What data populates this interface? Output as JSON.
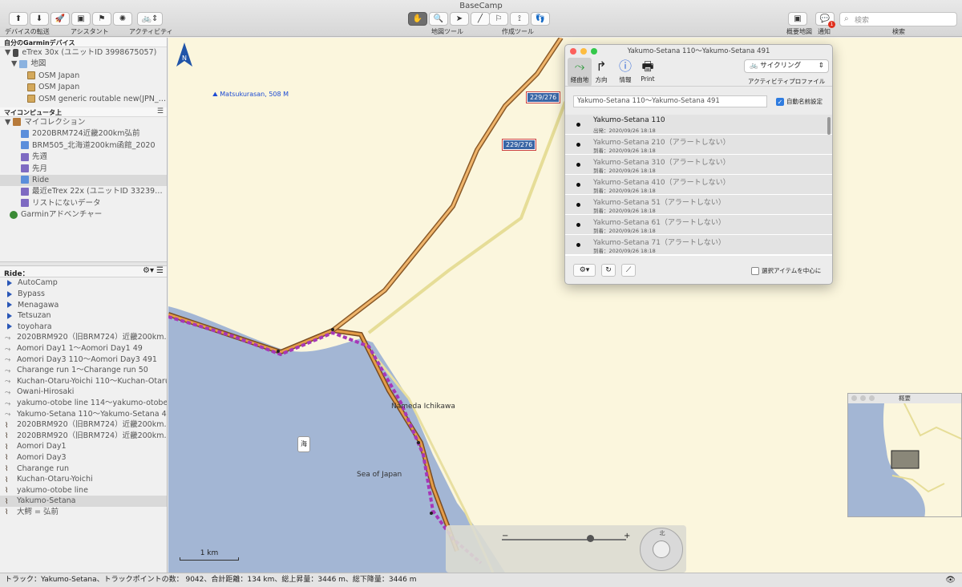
{
  "window": {
    "title": "BaseCamp"
  },
  "toolbar": {
    "groups": [
      {
        "label": "デバイスの転送"
      },
      {
        "label": "アシスタント"
      },
      {
        "label": "アクティビティ"
      },
      {
        "label": "地図ツール"
      },
      {
        "label": "作成ツール"
      },
      {
        "label": "概要地図"
      },
      {
        "label": "通知"
      },
      {
        "label": "検索"
      }
    ],
    "search_placeholder": "検索",
    "notification_count": "1"
  },
  "sidebar": {
    "device_header": "自分のGarminデバイス",
    "device_items": [
      {
        "label": "eTrex 30x (ユニットID 3998675057)"
      },
      {
        "label": "地図"
      },
      {
        "label": "OSM Japan"
      },
      {
        "label": "OSM Japan"
      },
      {
        "label": "OSM generic routable new(JPN_2..."
      }
    ],
    "computer_header": "マイコンピュータ上",
    "collection_items": [
      {
        "label": "マイコレクション"
      },
      {
        "label": "2020BRM724近畿200km弘前"
      },
      {
        "label": "BRM505_北海道200km函館_2020"
      },
      {
        "label": "先週"
      },
      {
        "label": "先月"
      },
      {
        "label": "Ride"
      },
      {
        "label": "最近eTrex 22x (ユニットID 332397..."
      },
      {
        "label": "リストにないデータ"
      },
      {
        "label": "Garminアドベンチャー"
      }
    ],
    "ride_header": "Ride：",
    "ride_items": [
      {
        "label": "AutoCamp",
        "kind": "flag"
      },
      {
        "label": "Bypass",
        "kind": "flag"
      },
      {
        "label": "Menagawa",
        "kind": "flag"
      },
      {
        "label": "Tetsuzan",
        "kind": "flag"
      },
      {
        "label": "toyohara",
        "kind": "flag"
      },
      {
        "label": "2020BRM920（旧BRM724）近畿200km...",
        "kind": "route"
      },
      {
        "label": "Aomori Day1 1〜Aomori Day1 49",
        "kind": "route"
      },
      {
        "label": "Aomori Day3 110〜Aomori Day3 491",
        "kind": "route"
      },
      {
        "label": "Charange run 1〜Charange run 50",
        "kind": "route"
      },
      {
        "label": "Kuchan-Otaru-Yoichi 110〜Kuchan-Otaru...",
        "kind": "route"
      },
      {
        "label": "Owani-Hirosaki",
        "kind": "route"
      },
      {
        "label": "yakumo-otobe line 114〜yakumo-otobe li...",
        "kind": "route"
      },
      {
        "label": "Yakumo-Setana 110〜Yakumo-Setana 491",
        "kind": "route"
      },
      {
        "label": "2020BRM920（旧BRM724）近畿200km...",
        "kind": "track"
      },
      {
        "label": "2020BRM920（旧BRM724）近畿200km...",
        "kind": "track"
      },
      {
        "label": "Aomori Day1",
        "kind": "track"
      },
      {
        "label": "Aomori Day3",
        "kind": "track"
      },
      {
        "label": "Charange run",
        "kind": "track"
      },
      {
        "label": "Kuchan-Otaru-Yoichi",
        "kind": "track"
      },
      {
        "label": "yakumo-otobe line",
        "kind": "track"
      },
      {
        "label": "Yakumo-Setana",
        "kind": "track"
      },
      {
        "label": "大鰐 = 弘前",
        "kind": "track"
      }
    ]
  },
  "map": {
    "poi_label": "Matsukurasan, 508 M",
    "shield_1": "229/276",
    "shield_2": "229/276",
    "place_label": "Nameda Ichikawa",
    "sea_label": "Sea of Japan",
    "pin_label": "海",
    "scale_label": "1 km",
    "compass_north": "北"
  },
  "info_window": {
    "title": "Yakumo-Setana 110〜Yakumo-Setana 491",
    "tabs": [
      {
        "label": "経由地"
      },
      {
        "label": "方向"
      },
      {
        "label": "情報"
      },
      {
        "label": "Print"
      }
    ],
    "profile_value": "サイクリング",
    "profile_label": "アクティビティプロファイル",
    "name_value": "Yakumo-Setana 110〜Yakumo-Setana 491",
    "auto_name_label": "自動名前設定",
    "vias": [
      {
        "name": "Yakumo-Setana 110",
        "sub": "出発：2020/09/26 18:18"
      },
      {
        "name": "Yakumo-Setana 210（アラートしない）",
        "sub": "到着：2020/09/26 18:18"
      },
      {
        "name": "Yakumo-Setana 310（アラートしない）",
        "sub": "到着：2020/09/26 18:18"
      },
      {
        "name": "Yakumo-Setana 410（アラートしない）",
        "sub": "到着：2020/09/26 18:18"
      },
      {
        "name": "Yakumo-Setana 51（アラートしない）",
        "sub": "到着：2020/09/26 18:18"
      },
      {
        "name": "Yakumo-Setana 61（アラートしない）",
        "sub": "到着：2020/09/26 18:18"
      },
      {
        "name": "Yakumo-Setana 71（アラートしない）",
        "sub": "到着：2020/09/26 18:18"
      }
    ],
    "center_label": "選択アイテムを中心に"
  },
  "overview": {
    "title": "概要"
  },
  "status_bar": {
    "text": "トラック：Yakumo-Setana、トラックポイントの数： 9042、合計距離：134 km、総上昇量：3446 m、総下降量：3446 m"
  },
  "colors": {
    "sea": "#a3b6d4",
    "land": "#fbf6dd",
    "track": "#e59d48",
    "route": "#a637b8"
  }
}
